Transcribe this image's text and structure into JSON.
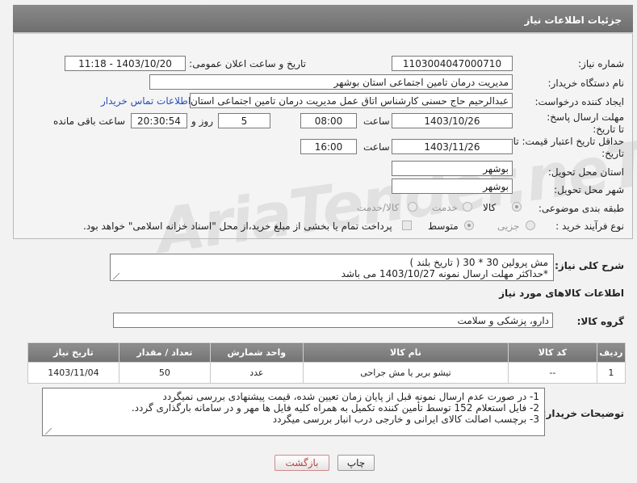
{
  "header": {
    "title": "جزئیات اطلاعات نیاز"
  },
  "fields": {
    "need_number_label": "شماره نیاز:",
    "need_number": "1103004047000710",
    "announce_label": "تاریخ و ساعت اعلان عمومی:",
    "announce_value": "1403/10/20 - 11:18",
    "buyer_org_label": "نام دستگاه خریدار:",
    "buyer_org": "مدیریت درمان تامین اجتماعی استان بوشهر",
    "creator_label": "ایجاد کننده درخواست:",
    "creator": "عبدالرحیم حاج حسنی کارشناس اتاق عمل مدیریت درمان تامین اجتماعی استان",
    "contact_link": "اطلاعات تماس خریدار",
    "reply_deadline_label": "مهلت ارسال پاسخ: تا تاریخ:",
    "reply_date": "1403/10/26",
    "time_word": "ساعت",
    "reply_time": "08:00",
    "days": "5",
    "days_word": "روز و",
    "remaining_time": "20:30:54",
    "remaining_word": "ساعت باقی مانده",
    "price_validity_label": "حداقل تاریخ اعتبار قیمت: تا تاریخ:",
    "price_date": "1403/11/26",
    "price_time": "16:00",
    "province_label": "استان محل تحویل:",
    "province": "بوشهر",
    "city_label": "شهر محل تحویل:",
    "city": "بوشهر",
    "category_label": "طبقه بندی موضوعی:",
    "category_options": [
      "کالا",
      "خدمت",
      "کالا/خدمت"
    ],
    "process_label": "نوع فرآیند خرید :",
    "process_options": [
      "جزیی",
      "متوسط"
    ],
    "payment_note": "پرداخت تمام یا بخشی از مبلغ خرید،از محل \"اسناد خزانه اسلامی\" خواهد بود."
  },
  "description": {
    "label": "شرح کلی نیاز:",
    "line1": "مش پرولین 30 * 30 ( تاریخ بلند )",
    "line2": "*حداکثر مهلت ارسال نمونه 1403/10/27 می باشد"
  },
  "goods_section": {
    "title": "اطلاعات کالاهای مورد نیاز",
    "group_label": "گروه کالا:",
    "group_value": "دارو، پزشکی و سلامت"
  },
  "table": {
    "headers": [
      "ردیف",
      "کد کالا",
      "نام کالا",
      "واحد شمارش",
      "تعداد / مقدار",
      "تاریخ نیاز"
    ],
    "rows": [
      [
        "1",
        "--",
        "تیشو بریر یا مش جراحی",
        "عدد",
        "50",
        "1403/11/04"
      ]
    ]
  },
  "buyer_notes": {
    "label": "توضیحات خریدار:",
    "line1": "1- در صورت عدم ارسال نمونه قبل از پایان زمان تعیین شده، قیمت پیشنهادی بررسی نمیگردد",
    "line2": "2- فایل استعلام 152 توسط تأمین کننده تکمیل به همراه کلیه فایل ها مهر و در سامانه بارگذاری گردد.",
    "line3": "3- برچسب اصالت کالای ایرانی و خارجی درب انبار بررسی میگردد"
  },
  "buttons": {
    "print": "چاپ",
    "back": "بازگشت"
  },
  "watermark": "AriaTender.neT"
}
